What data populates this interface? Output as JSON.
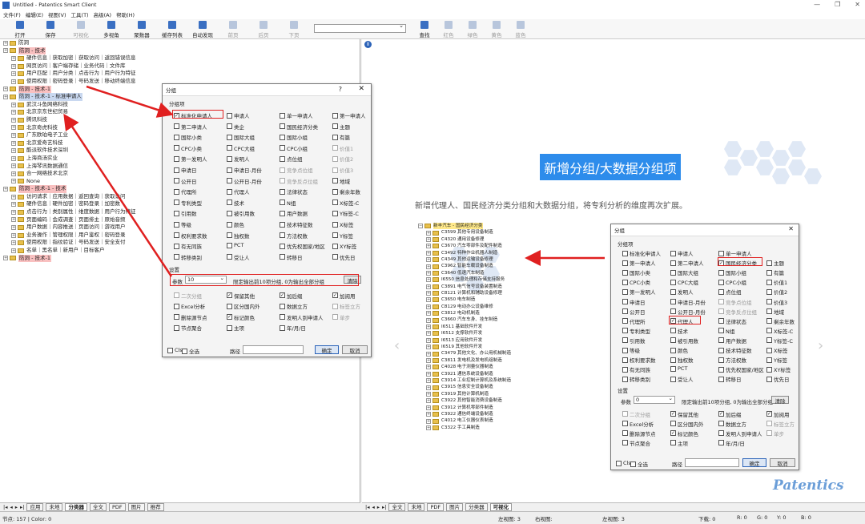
{
  "window": {
    "title": "Untitled - Patentics Smart Client"
  },
  "menu": [
    "文件(F)",
    "编辑(E)",
    "视图(V)",
    "工具(T)",
    "高级(A)",
    "帮助(H)"
  ],
  "toolbar": {
    "buttons": [
      {
        "label": "打开",
        "enabled": true
      },
      {
        "label": "保存",
        "enabled": true
      },
      {
        "label": "可视化",
        "enabled": false
      },
      {
        "label": "多视角",
        "enabled": true
      },
      {
        "label": "聚数器",
        "enabled": true
      },
      {
        "label": "缓存列表",
        "enabled": true
      },
      {
        "label": "自动发现",
        "enabled": true
      },
      {
        "label": "前页",
        "enabled": false
      },
      {
        "label": "后页",
        "enabled": false
      },
      {
        "label": "下页",
        "enabled": false
      }
    ],
    "buttons2": [
      {
        "label": "查找",
        "enabled": true
      },
      {
        "label": "红色",
        "enabled": false
      },
      {
        "label": "绿色",
        "enabled": false
      },
      {
        "label": "黄色",
        "enabled": false
      },
      {
        "label": "蓝色",
        "enabled": false
      }
    ]
  },
  "left_tree": [
    {
      "d": 0,
      "t": "防洞",
      "h": ""
    },
    {
      "d": 0,
      "t": "防洞 - 技术",
      "h": "red"
    },
    {
      "d": 1,
      "t": "硬件信息｜获取加密｜获取访问｜返回错误信息",
      "h": ""
    },
    {
      "d": 1,
      "t": "网页访问｜客户端存储｜业务代码｜文件库",
      "h": ""
    },
    {
      "d": 1,
      "t": "用户匹配｜用户分类｜点击行为｜用户行为特征",
      "h": ""
    },
    {
      "d": 1,
      "t": "使用权限｜密码登录｜号码发送｜移动终端信息",
      "h": ""
    },
    {
      "d": 0,
      "t": "防洞 - 技术-1",
      "h": "red"
    },
    {
      "d": 0,
      "t": "防洞 - 技术-1 - 标准申请人",
      "h": "blue"
    },
    {
      "d": 1,
      "t": "武汉斗鱼网络科技",
      "h": ""
    },
    {
      "d": 1,
      "t": "北京京东世纪贸易",
      "h": ""
    },
    {
      "d": 1,
      "t": "腾讯科技",
      "h": ""
    },
    {
      "d": 1,
      "t": "北京奇虎科技",
      "h": ""
    },
    {
      "d": 1,
      "t": "广东欧珀电子工业",
      "h": ""
    },
    {
      "d": 1,
      "t": "北京爱奇艺科技",
      "h": ""
    },
    {
      "d": 1,
      "t": "酷派软件技术深圳",
      "h": ""
    },
    {
      "d": 1,
      "t": "上海商汤实业",
      "h": ""
    },
    {
      "d": 1,
      "t": "上海琴讯数据通信",
      "h": ""
    },
    {
      "d": 1,
      "t": "合一网络技术北京",
      "h": ""
    },
    {
      "d": 1,
      "t": "None",
      "h": ""
    },
    {
      "d": 0,
      "t": "防洞 - 技术-1 - 技术",
      "h": "red"
    },
    {
      "d": 1,
      "t": "访问请求｜应用数据｜返回查询｜获取访问",
      "h": ""
    },
    {
      "d": 1,
      "t": "硬件信息｜硬件加密｜密码登录｜加密数",
      "h": ""
    },
    {
      "d": 1,
      "t": "点击行为｜类别属性｜维度数据｜用户行为特征",
      "h": ""
    },
    {
      "d": 1,
      "t": "页面编码｜会成调查｜页面排主｜原始音频",
      "h": ""
    },
    {
      "d": 1,
      "t": "用户数据｜内容推送｜页面访问｜游戏用户",
      "h": ""
    },
    {
      "d": 1,
      "t": "业务操作｜管理权限｜用户鉴权｜密码登录",
      "h": ""
    },
    {
      "d": 1,
      "t": "使用权限｜指纹验证｜号码发送｜安全支付",
      "h": ""
    },
    {
      "d": 1,
      "t": "名单｜黑名单｜新用户｜目标客户",
      "h": ""
    },
    {
      "d": 0,
      "t": "防洞 - 技术-1",
      "h": "red"
    }
  ],
  "left_tabs": [
    "应用",
    "未地",
    "分类器",
    "全文",
    "PDF",
    "图片",
    "推荐"
  ],
  "right_tabs": [
    "全文",
    "未地",
    "PDF",
    "图片",
    "分类器",
    "可视化"
  ],
  "dialog1": {
    "title": "分组",
    "help": "?",
    "close": "✕",
    "group_label": "分组项",
    "items": [
      {
        "l": "标准化申请人",
        "c": true,
        "g": false
      },
      {
        "l": "申请人",
        "c": false,
        "g": false
      },
      {
        "l": "单一申请人",
        "c": false,
        "g": false
      },
      {
        "l": "第一申请人",
        "c": false,
        "g": false
      },
      {
        "l": "第二申请人",
        "c": false,
        "g": false
      },
      {
        "l": "类企",
        "c": false,
        "g": false
      },
      {
        "l": "国民经济分类",
        "c": false,
        "g": false
      },
      {
        "l": "主题",
        "c": false,
        "g": false
      },
      {
        "l": "国际小类",
        "c": false,
        "g": false
      },
      {
        "l": "国际大组",
        "c": false,
        "g": false
      },
      {
        "l": "国际小组",
        "c": false,
        "g": false
      },
      {
        "l": "有篇",
        "c": false,
        "g": false
      },
      {
        "l": "CPC小类",
        "c": false,
        "g": false
      },
      {
        "l": "CPC大组",
        "c": false,
        "g": false
      },
      {
        "l": "CPC小组",
        "c": false,
        "g": false
      },
      {
        "l": "价值1",
        "c": false,
        "g": true
      },
      {
        "l": "第一发明人",
        "c": false,
        "g": false
      },
      {
        "l": "发明人",
        "c": false,
        "g": false
      },
      {
        "l": "点位组",
        "c": false,
        "g": false
      },
      {
        "l": "价值2",
        "c": false,
        "g": true
      },
      {
        "l": "申请日",
        "c": false,
        "g": false
      },
      {
        "l": "申请日-月份",
        "c": false,
        "g": false
      },
      {
        "l": "竞争点位组",
        "c": false,
        "g": true
      },
      {
        "l": "价值3",
        "c": false,
        "g": true
      },
      {
        "l": "公开日",
        "c": false,
        "g": false
      },
      {
        "l": "公开日-月份",
        "c": false,
        "g": false
      },
      {
        "l": "竞争反点位组",
        "c": false,
        "g": true
      },
      {
        "l": "地域",
        "c": false,
        "g": false
      },
      {
        "l": "代理所",
        "c": false,
        "g": false
      },
      {
        "l": "代理人",
        "c": false,
        "g": false
      },
      {
        "l": "法律状态",
        "c": false,
        "g": false
      },
      {
        "l": "剩余年数",
        "c": false,
        "g": false
      },
      {
        "l": "专利类型",
        "c": false,
        "g": false
      },
      {
        "l": "技术",
        "c": false,
        "g": false
      },
      {
        "l": "N组",
        "c": false,
        "g": false
      },
      {
        "l": "X标签-C",
        "c": false,
        "g": false
      },
      {
        "l": "引用数",
        "c": false,
        "g": false
      },
      {
        "l": "被引用数",
        "c": false,
        "g": false
      },
      {
        "l": "用户数据",
        "c": false,
        "g": false
      },
      {
        "l": "Y标签-C",
        "c": false,
        "g": false
      },
      {
        "l": "等级",
        "c": false,
        "g": false
      },
      {
        "l": "颜色",
        "c": false,
        "g": false
      },
      {
        "l": "技术特征数",
        "c": false,
        "g": false
      },
      {
        "l": "X标签",
        "c": false,
        "g": false
      },
      {
        "l": "权利要求数",
        "c": false,
        "g": false
      },
      {
        "l": "独权数",
        "c": false,
        "g": false
      },
      {
        "l": "方法权数",
        "c": false,
        "g": false
      },
      {
        "l": "Y标签",
        "c": false,
        "g": false
      },
      {
        "l": "有无同族",
        "c": false,
        "g": false
      },
      {
        "l": "PCT",
        "c": false,
        "g": false
      },
      {
        "l": "优先权国家/地区",
        "c": false,
        "g": false
      },
      {
        "l": "XY标签",
        "c": false,
        "g": false
      },
      {
        "l": "转移类别",
        "c": false,
        "g": false
      },
      {
        "l": "受让人",
        "c": false,
        "g": false
      },
      {
        "l": "转移日",
        "c": false,
        "g": false
      },
      {
        "l": "优先日",
        "c": false,
        "g": false
      }
    ],
    "settings_label": "设置",
    "param_label": "参数",
    "param_value": "10",
    "limit_text": "限定输出前10项分组, 0为输出全部分组",
    "clear_label": "清除",
    "options": [
      {
        "l": "二次分组",
        "c": false,
        "g": true
      },
      {
        "l": "保留其他",
        "c": true,
        "g": false
      },
      {
        "l": "加后缀",
        "c": true,
        "g": false
      },
      {
        "l": "加阅用",
        "c": true,
        "g": false
      },
      {
        "l": "Excel分析",
        "c": false,
        "g": false
      },
      {
        "l": "区分国内外",
        "c": false,
        "g": false
      },
      {
        "l": "数据立方",
        "c": false,
        "g": false
      },
      {
        "l": "标签立方",
        "c": false,
        "g": true
      },
      {
        "l": "删除源节点",
        "c": false,
        "g": false
      },
      {
        "l": "标记颜色",
        "c": true,
        "g": false
      },
      {
        "l": "发明人到申请人",
        "c": false,
        "g": false
      },
      {
        "l": "单步",
        "c": false,
        "g": true
      },
      {
        "l": "节点聚合",
        "c": false,
        "g": false
      },
      {
        "l": "主项",
        "c": false,
        "g": false
      },
      {
        "l": "年/月/日",
        "c": false,
        "g": false
      }
    ],
    "cls_label": "Cls",
    "select_all_label": "全选",
    "path_label": "路径",
    "ok_label": "确定",
    "cancel_label": "取消"
  },
  "dialog2": {
    "title": "分组",
    "close": "✕",
    "group_label": "分组项",
    "items": [
      {
        "l": "标准化申请人",
        "c": false,
        "g": false
      },
      {
        "l": "申请人",
        "c": false,
        "g": false
      },
      {
        "l": "单一申请人",
        "c": false,
        "g": false
      },
      {
        "l": "",
        "c": false,
        "g": false
      },
      {
        "l": "第一申请人",
        "c": false,
        "g": false
      },
      {
        "l": "第二申请人",
        "c": false,
        "g": false
      },
      {
        "l": "国民经济分类",
        "c": true,
        "g": false
      },
      {
        "l": "主题",
        "c": false,
        "g": false
      },
      {
        "l": "国际小类",
        "c": false,
        "g": false
      },
      {
        "l": "国际大组",
        "c": false,
        "g": false
      },
      {
        "l": "国际小组",
        "c": false,
        "g": false
      },
      {
        "l": "有篇",
        "c": false,
        "g": false
      },
      {
        "l": "CPC小类",
        "c": false,
        "g": false
      },
      {
        "l": "CPC大组",
        "c": false,
        "g": false
      },
      {
        "l": "CPC小组",
        "c": false,
        "g": false
      },
      {
        "l": "价值1",
        "c": false,
        "g": false
      },
      {
        "l": "第一发明人",
        "c": false,
        "g": false
      },
      {
        "l": "发明人",
        "c": false,
        "g": false
      },
      {
        "l": "点位组",
        "c": false,
        "g": false
      },
      {
        "l": "价值2",
        "c": false,
        "g": false
      },
      {
        "l": "申请日",
        "c": false,
        "g": false
      },
      {
        "l": "申请日-月份",
        "c": false,
        "g": false
      },
      {
        "l": "竞争点位组",
        "c": false,
        "g": true
      },
      {
        "l": "价值3",
        "c": false,
        "g": false
      },
      {
        "l": "公开日",
        "c": false,
        "g": false
      },
      {
        "l": "公开日-月份",
        "c": false,
        "g": false
      },
      {
        "l": "竞争反点位组",
        "c": false,
        "g": true
      },
      {
        "l": "地域",
        "c": false,
        "g": false
      },
      {
        "l": "代理所",
        "c": false,
        "g": false
      },
      {
        "l": "代理人",
        "c": true,
        "g": false
      },
      {
        "l": "法律状态",
        "c": false,
        "g": false
      },
      {
        "l": "剩余年数",
        "c": false,
        "g": false
      },
      {
        "l": "专利类型",
        "c": false,
        "g": false
      },
      {
        "l": "技术",
        "c": false,
        "g": false
      },
      {
        "l": "N组",
        "c": false,
        "g": false
      },
      {
        "l": "X标签-C",
        "c": false,
        "g": false
      },
      {
        "l": "引用数",
        "c": false,
        "g": false
      },
      {
        "l": "被引用数",
        "c": false,
        "g": false
      },
      {
        "l": "用户数据",
        "c": false,
        "g": false
      },
      {
        "l": "Y标签-C",
        "c": false,
        "g": false
      },
      {
        "l": "等级",
        "c": false,
        "g": false
      },
      {
        "l": "颜色",
        "c": false,
        "g": false
      },
      {
        "l": "技术特征数",
        "c": false,
        "g": false
      },
      {
        "l": "X标签",
        "c": false,
        "g": false
      },
      {
        "l": "权利要求数",
        "c": false,
        "g": false
      },
      {
        "l": "独权数",
        "c": false,
        "g": false
      },
      {
        "l": "方法权数",
        "c": false,
        "g": false
      },
      {
        "l": "Y标签",
        "c": false,
        "g": false
      },
      {
        "l": "有无同族",
        "c": false,
        "g": false
      },
      {
        "l": "PCT",
        "c": false,
        "g": false
      },
      {
        "l": "优先权国家/地区",
        "c": false,
        "g": false
      },
      {
        "l": "XY标签",
        "c": false,
        "g": false
      },
      {
        "l": "转移类别",
        "c": false,
        "g": false
      },
      {
        "l": "受让人",
        "c": false,
        "g": false
      },
      {
        "l": "转移日",
        "c": false,
        "g": false
      },
      {
        "l": "优先日",
        "c": false,
        "g": false
      }
    ],
    "settings_label": "设置",
    "param_label": "参数",
    "param_value": "0",
    "limit_text": "限定输出前10项分组, 0为输出全部分组",
    "clear_label": "清除",
    "options": [
      {
        "l": "二次分组",
        "c": false,
        "g": true
      },
      {
        "l": "保留其他",
        "c": true,
        "g": false
      },
      {
        "l": "加后缀",
        "c": true,
        "g": false
      },
      {
        "l": "加阅用",
        "c": true,
        "g": false
      },
      {
        "l": "Excel分析",
        "c": false,
        "g": false
      },
      {
        "l": "区分国内外",
        "c": false,
        "g": false
      },
      {
        "l": "数据立方",
        "c": false,
        "g": false
      },
      {
        "l": "标签立方",
        "c": false,
        "g": true
      },
      {
        "l": "删除源节点",
        "c": false,
        "g": false
      },
      {
        "l": "标记颜色",
        "c": true,
        "g": false
      },
      {
        "l": "发明人到申请人",
        "c": false,
        "g": false
      },
      {
        "l": "单步",
        "c": false,
        "g": true
      },
      {
        "l": "节点聚合",
        "c": false,
        "g": false
      },
      {
        "l": "主项",
        "c": false,
        "g": false
      },
      {
        "l": "年/月/日",
        "c": false,
        "g": false
      }
    ],
    "cls_label": "Cls",
    "select_all_label": "全选",
    "path_label": "路径",
    "ok_label": "确定",
    "cancel_label": "取消"
  },
  "promo": {
    "title": "新增分组/大数据分组项",
    "subtitle": "新增代理人、国民经济分类分组和大数据分组，将专利分析的维度再次扩展。",
    "watermark": "Patentics"
  },
  "class_tree": {
    "root": "新丰汽车 - 国民经济分类",
    "items": [
      "C3599 其他专用设备制造",
      "C4320 通用设备修理",
      "C3670 汽车零部件及配件制造",
      "C3492 特种作业机器人制造",
      "C4349 其他运输设备修理",
      "C3962 智能车载设备制造",
      "C3640 低速汽车制造",
      "I6550 信息处理和存储支持服务",
      "C3891 电气信号设备装置制造",
      "C8121 计算机和辅助设备修理",
      "C3650 电车制造",
      "C8129 电动办公设备维修",
      "C3812 电动机制造",
      "C3660 汽车车身、挂车制造",
      "I6511 基础软件开发",
      "I6512 支撑软件开发",
      "I6513 应用软件开发",
      "I6519 其他软件开发",
      "C3479 其他文化、办公用机械制造",
      "C3811 发电机及发电机组制造",
      "C4028 电子测量仪器制造",
      "C3921 通信系统设备制造",
      "C3914 工业控制计算机及系统制造",
      "C3915 信息安全设备制造",
      "C3919 其他计算机制造",
      "C3922 其他智能消费设备制造",
      "C3912 计算机零部件制造",
      "C3922 通信终端设备制造",
      "C4012 电工仪器仪表制造",
      "C3322 手工具制造"
    ]
  },
  "status": {
    "left": "节点: 157 | Color: 0",
    "left_view": "左视图: 3",
    "right_view": "右视图:",
    "left_view2": "左视图: 3",
    "down": "下载: 0",
    "r": "R: 0",
    "g": "G: 0",
    "y": "Y: 0",
    "b": "B: 0"
  },
  "colors": {
    "accent": "#2d8ceb",
    "highlight_red": "#e02020"
  }
}
